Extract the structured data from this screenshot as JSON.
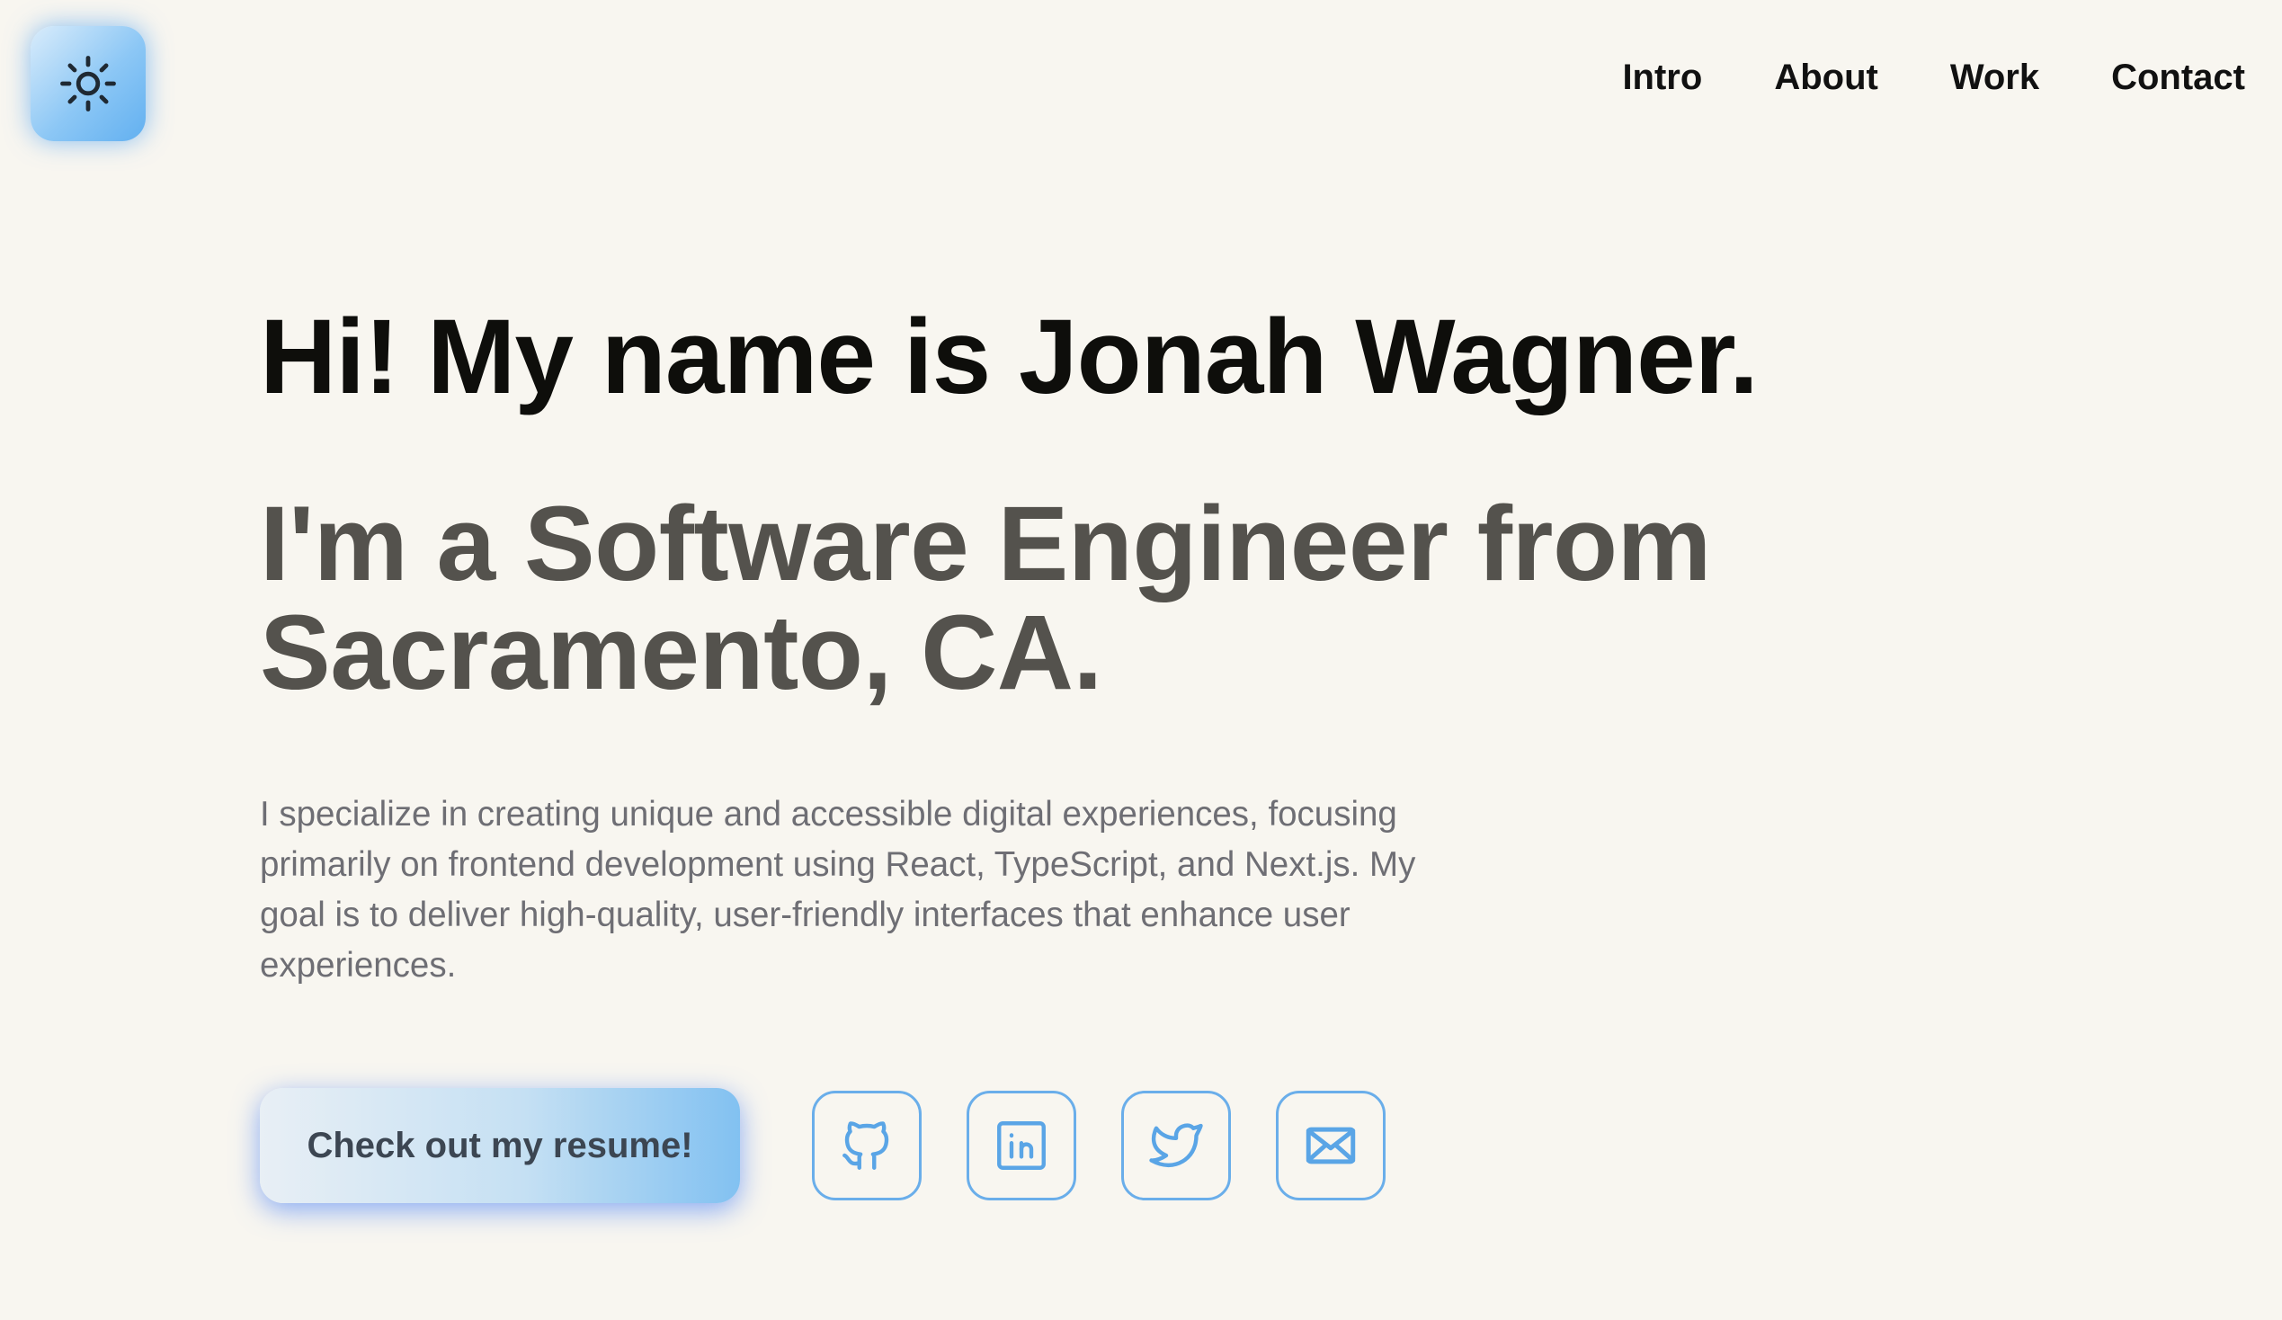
{
  "theme_toggle": {
    "icon": "sun-icon"
  },
  "nav": {
    "items": [
      {
        "label": "Intro"
      },
      {
        "label": "About"
      },
      {
        "label": "Work"
      },
      {
        "label": "Contact"
      }
    ]
  },
  "hero": {
    "greeting": "Hi! My name is Jonah Wagner.",
    "role": "I'm a Software Engineer from Sacramento, CA.",
    "bio": "I specialize in creating unique and accessible digital experiences, focusing primarily on frontend development using React, TypeScript, and Next.js. My goal is to deliver high-quality, user-friendly interfaces that enhance user experiences.",
    "resume_label": "Check out my resume!"
  },
  "socials": [
    {
      "icon": "github-icon"
    },
    {
      "icon": "linkedin-icon"
    },
    {
      "icon": "twitter-icon"
    },
    {
      "icon": "mail-icon"
    }
  ],
  "colors": {
    "background": "#f8f6f0",
    "accent": "#6aaeea",
    "heading": "#0e0e0b",
    "subheading": "#54524d",
    "body_text": "#6e6e74"
  }
}
